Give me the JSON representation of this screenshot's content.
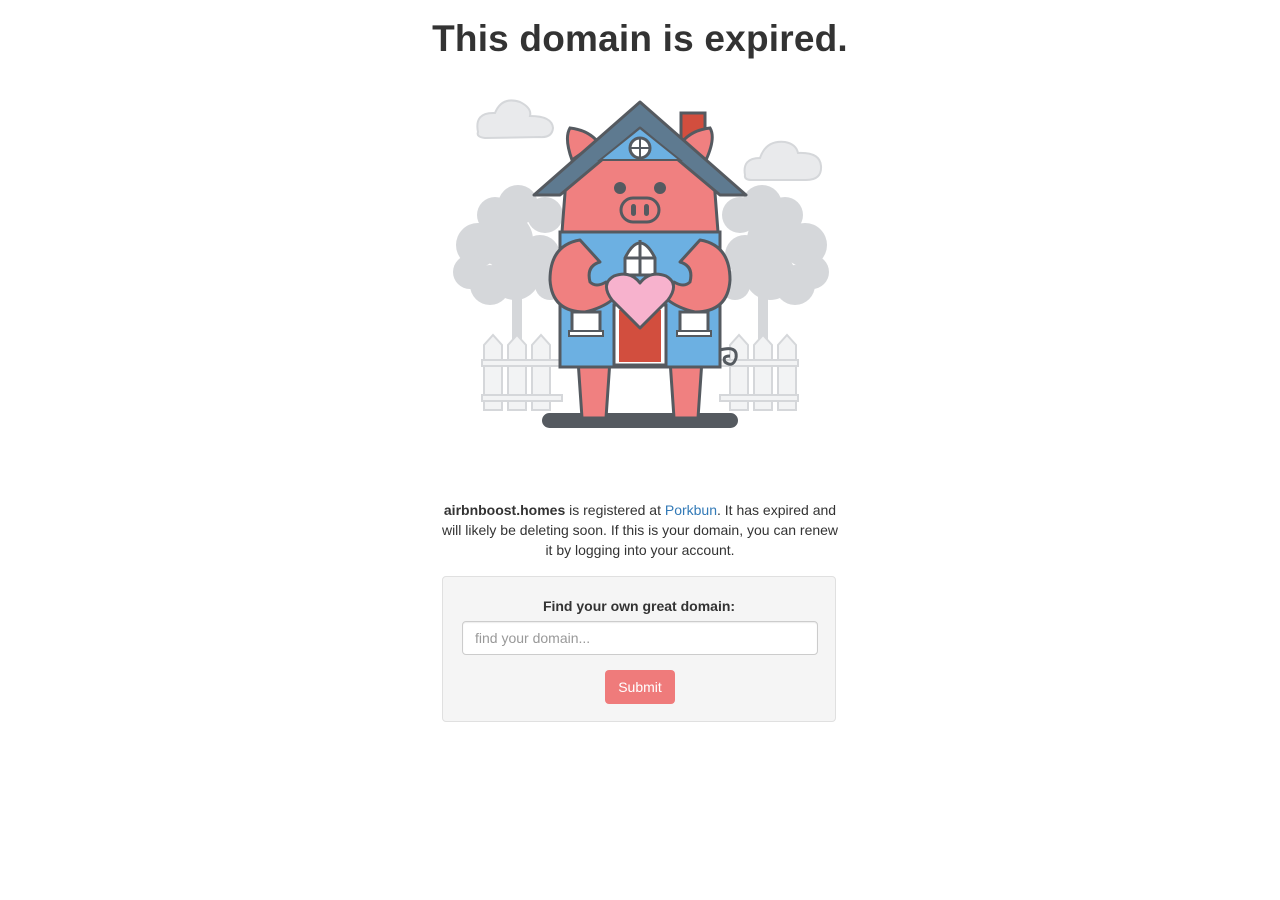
{
  "page": {
    "title": "This domain is expired."
  },
  "illustration": {
    "name": "pig-house-holding-heart",
    "colors": {
      "pig": "#f08080",
      "house": "#6cb0e2",
      "roof": "#5e7a90",
      "chimney": "#d24e3e",
      "heart": "#f7b2cd",
      "outline": "#555a60",
      "scenery": "#d5d7da"
    }
  },
  "message": {
    "domain": "airbnboost.homes",
    "text_before_link": " is registered at ",
    "registrar_link": "Porkbun",
    "text_after_link": ". It has expired and will likely be deleting soon. If this is your domain, you can renew it by logging into your account."
  },
  "search": {
    "label": "Find your own great domain:",
    "placeholder": "find your domain...",
    "value": "",
    "submit_label": "Submit"
  },
  "colors": {
    "accent": "#ef7b7b",
    "link": "#337ab7",
    "panel_bg": "#f5f5f5"
  }
}
